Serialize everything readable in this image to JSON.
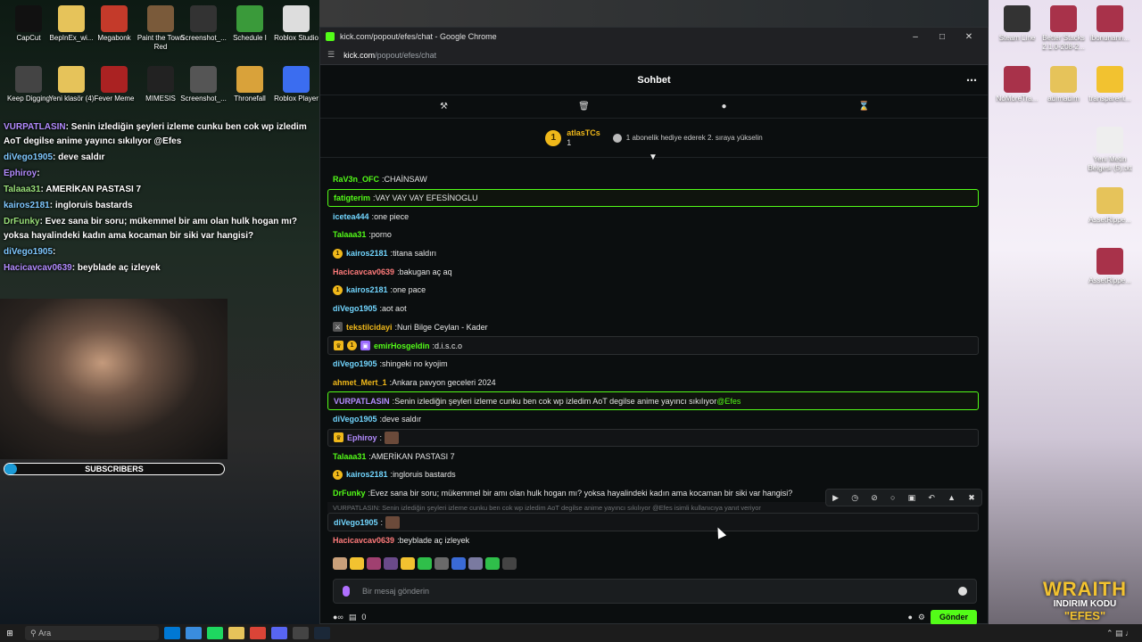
{
  "browser": {
    "window_title": "kick.com/popout/efes/chat - Google Chrome",
    "url_host": "kick.com",
    "url_path": "/popout/efes/chat"
  },
  "chat": {
    "title": "Sohbet",
    "pinned": {
      "user": "atlasTCs",
      "count": "1",
      "text": "1 abonelik hediye ederek 2. sıraya yükselin"
    },
    "messages": [
      {
        "user": "RaV3n_OFC",
        "text": "CHAİNSAW",
        "color": "#53fc18",
        "hl": "",
        "badges": []
      },
      {
        "user": "fatigterim",
        "text": "VAY VAY VAY EFESİNOGLU",
        "color": "#53fc18",
        "hl": "hl",
        "badges": []
      },
      {
        "user": "icetea444",
        "text": "one piece",
        "color": "#72d6ff",
        "hl": "",
        "badges": []
      },
      {
        "user": "Talaaa31",
        "text": "porno",
        "color": "#53fc18",
        "hl": "",
        "badges": []
      },
      {
        "user": "kairos2181",
        "text": "titana saldırı",
        "color": "#72d6ff",
        "hl": "",
        "badges": [
          "1"
        ]
      },
      {
        "user": "Hacicavcav0639",
        "text": "bakugan aç aq",
        "color": "#ff7b7b",
        "hl": "",
        "badges": []
      },
      {
        "user": "kairos2181",
        "text": "one pace",
        "color": "#72d6ff",
        "hl": "",
        "badges": [
          "1"
        ]
      },
      {
        "user": "diVego1905",
        "text": "aot aot",
        "color": "#72d6ff",
        "hl": "",
        "badges": []
      },
      {
        "user": "tekstilcidayi",
        "text": "Nuri Bilge Ceylan - Kader",
        "color": "#f0b81a",
        "hl": "",
        "badges": [
          "m"
        ]
      },
      {
        "user": "emirHosgeldin",
        "text": "d.i.s.c.o",
        "color": "#53fc18",
        "hl": "hl-dim",
        "badges": [
          "c",
          "1",
          "p"
        ]
      },
      {
        "user": "diVego1905",
        "text": "shingeki no kyojim",
        "color": "#72d6ff",
        "hl": "",
        "badges": []
      },
      {
        "user": "ahmet_Mert_1",
        "text": "Ankara pavyon geceleri 2024",
        "color": "#f0b81a",
        "hl": "",
        "badges": []
      },
      {
        "user": "VURPATLASIN",
        "text": "Senin izlediğin şeyleri izleme cunku ben cok wp izledim AoT degilse anime yayıncı sıkılıyor ",
        "mention": "@Efes",
        "color": "#b38cff",
        "hl": "hl",
        "badges": []
      },
      {
        "user": "diVego1905",
        "text": "deve saldır",
        "color": "#72d6ff",
        "hl": "",
        "badges": []
      },
      {
        "user": "Ephiroy",
        "text": "",
        "color": "#b38cff",
        "hl": "hl-dim",
        "badges": [
          "c"
        ],
        "emote": true
      },
      {
        "user": "Talaaa31",
        "text": "AMERİKAN PASTASI 7",
        "color": "#53fc18",
        "hl": "",
        "badges": []
      },
      {
        "user": "kairos2181",
        "text": "ingloruis bastards",
        "color": "#72d6ff",
        "hl": "",
        "badges": [
          "1"
        ]
      },
      {
        "user": "DrFunky",
        "text": "Evez sana bir soru; mükemmel bir amı olan hulk hogan mı? yoksa hayalindeki kadın ama kocaman bir siki var hangisi?",
        "color": "#53fc18",
        "hl": "",
        "badges": []
      }
    ],
    "reply_context": "VURPATLASIN: Senin izlediğin şeyleri izleme cunku ben cok wp izledim AoT degilse anime yayıncı sıkılıyor @Efes isimli kullanıcıya yanıt veriyor",
    "reply_message": {
      "user": "diVego1905",
      "color": "#72d6ff"
    },
    "last_message": {
      "user": "Hacicavcav0639",
      "text": "beyblade aç izleyek",
      "color": "#ff7b7b"
    },
    "composer_placeholder": "Bir mesaj gönderin",
    "send_label": "Gönder",
    "points": "0"
  },
  "overlay": {
    "lines": [
      {
        "user": "VURPATLASIN",
        "text": ": Senin izlediğin şeyleri izleme cunku ben cok wp izledim",
        "cls": ""
      },
      {
        "user": "",
        "text": "AoT degilse anime yayıncı sıkılıyor @Efes",
        "cls": ""
      },
      {
        "user": "diVego1905",
        "text": ": deve saldır",
        "cls": "c"
      },
      {
        "user": "Ephiroy",
        "text": ":",
        "cls": ""
      },
      {
        "user": "Talaaa31",
        "text": ": AMERİKAN PASTASI 7",
        "cls": "g"
      },
      {
        "user": "kairos2181",
        "text": ": ingloruis bastards",
        "cls": "c"
      },
      {
        "user": "DrFunky",
        "text": ": Evez sana bir soru; mükemmel bir amı olan hulk hogan mı?",
        "cls": "g"
      },
      {
        "user": "",
        "text": "yoksa hayalindeki kadın ama kocaman bir siki var hangisi?",
        "cls": ""
      },
      {
        "user": "diVego1905",
        "text": ":",
        "cls": "c"
      },
      {
        "user": "Hacicavcav0639",
        "text": ": beyblade aç izleyek",
        "cls": ""
      }
    ],
    "subs_label": "SUBSCRIBERS",
    "subs_count": "0",
    "subs_goal": "7",
    "wraith_1": "WRAITH",
    "wraith_2": "INDIRIM KODU",
    "wraith_3": "\"EFES\""
  },
  "desktop_icons": [
    {
      "label": "CapCut",
      "color": "#111"
    },
    {
      "label": "BepInEx_wi...",
      "color": "#e6c35a"
    },
    {
      "label": "Megabonk",
      "color": "#c43a2a"
    },
    {
      "label": "Paint the Town Red",
      "color": "#7a5a3a"
    },
    {
      "label": "Screenshot_...",
      "color": "#333"
    },
    {
      "label": "Schedule I",
      "color": "#3a9a3a"
    },
    {
      "label": "Roblox Studio",
      "color": "#ddd"
    },
    {
      "label": "Keep Digging",
      "color": "#444"
    },
    {
      "label": "Yeni klasör (4)",
      "color": "#e6c35a"
    },
    {
      "label": "Fever Meme",
      "color": "#aa2222"
    },
    {
      "label": "MIMESIS",
      "color": "#222"
    },
    {
      "label": "Screenshot_...",
      "color": "#555"
    },
    {
      "label": "Thronefall",
      "color": "#d9a23a"
    },
    {
      "label": "Roblox Player",
      "color": "#3b6df0"
    }
  ],
  "desktop_icons_right": [
    {
      "label": "Steam Line",
      "color": "#333"
    },
    {
      "label": "Better Stacks 2.1.0-208-2...",
      "color": "#a8324a"
    },
    {
      "label": "ibonunann...",
      "color": "#a8324a"
    },
    {
      "label": "NoMoreTra...",
      "color": "#a8324a"
    },
    {
      "label": "adımadım",
      "color": "#e6c35a"
    },
    {
      "label": "transparent...",
      "color": "#f2c230"
    },
    {
      "label": "Yeni Metin Belgesi (5).txt",
      "color": "#eee"
    },
    {
      "label": "AssetRippe...",
      "color": "#e6c35a"
    },
    {
      "label": "AssetRippe...",
      "color": "#a8324a"
    }
  ],
  "taskbar": {
    "search": "Ara"
  }
}
